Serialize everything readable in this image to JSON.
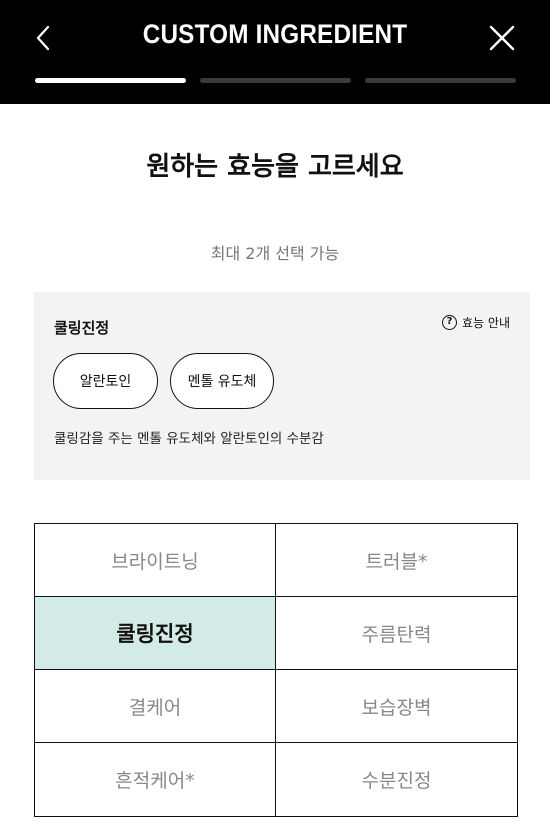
{
  "header": {
    "title": "CUSTOM INGREDIENT",
    "back_icon": "chevron-left-icon",
    "close_icon": "close-icon",
    "progress_current_step": 1,
    "progress_total_steps": 3
  },
  "question": {
    "title": "원하는 효능을 고르세요",
    "subtitle": "최대 2개 선택 가능"
  },
  "info_box": {
    "title": "쿨링진정",
    "guide_label": "효능 안내",
    "guide_icon": "question-circle-icon",
    "chips": [
      "알란토인",
      "멘톨 유도체"
    ],
    "description": "쿨링감을 주는 멘톨 유도체와 알란토인의 수분감"
  },
  "options": [
    {
      "label": "브라이트닝",
      "selected": false
    },
    {
      "label": "트러블*",
      "selected": false
    },
    {
      "label": "쿨링진정",
      "selected": true
    },
    {
      "label": "주름탄력",
      "selected": false
    },
    {
      "label": "결케어",
      "selected": false
    },
    {
      "label": "보습장벽",
      "selected": false
    },
    {
      "label": "흔적케어*",
      "selected": false
    },
    {
      "label": "수분진정",
      "selected": false
    }
  ],
  "colors": {
    "header_bg": "#000000",
    "selected_bg": "#d3ebe6",
    "info_box_bg": "#f3f3f3"
  }
}
